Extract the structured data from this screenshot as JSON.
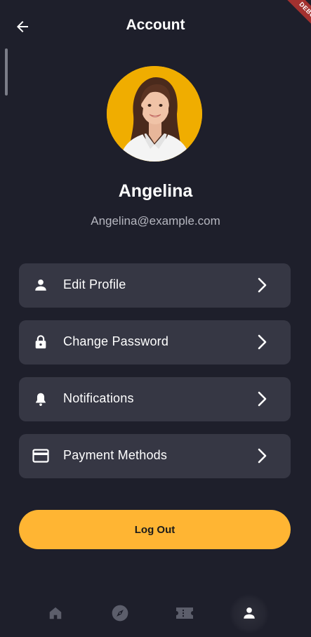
{
  "header": {
    "title": "Account",
    "debug_label": "DEBUG"
  },
  "profile": {
    "name": "Angelina",
    "email": "Angelina@example.com"
  },
  "menu": [
    {
      "label": "Edit Profile",
      "icon": "person-icon"
    },
    {
      "label": "Change Password",
      "icon": "lock-icon"
    },
    {
      "label": "Notifications",
      "icon": "bell-icon"
    },
    {
      "label": "Payment Methods",
      "icon": "credit-card-icon"
    }
  ],
  "logout": {
    "label": "Log Out"
  },
  "bottom_nav": [
    {
      "name": "home",
      "icon": "home-icon",
      "active": false
    },
    {
      "name": "explore",
      "icon": "compass-icon",
      "active": false
    },
    {
      "name": "tickets",
      "icon": "ticket-icon",
      "active": false
    },
    {
      "name": "account",
      "icon": "person-icon",
      "active": true
    }
  ],
  "colors": {
    "background": "#1e1f2b",
    "card": "#363744",
    "accent": "#ffb533",
    "avatar_bg": "#f0ad00",
    "muted_text": "#b6b7c0",
    "nav_inactive": "#5c5e6b"
  }
}
